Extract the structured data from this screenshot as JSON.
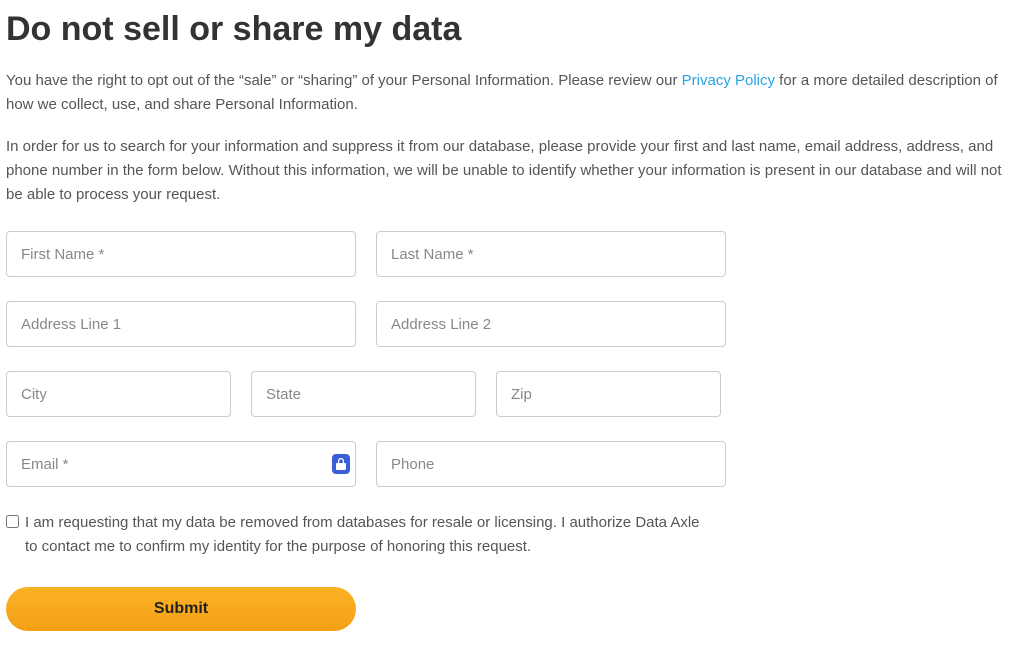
{
  "title": "Do not sell or share my data",
  "intro1_pre": "You have the right to opt out of the “sale” or “sharing” of your Personal Information. Please review our ",
  "privacy_link_text": "Privacy Policy",
  "intro1_post": " for a more detailed description of how we collect, use, and share Personal Information.",
  "intro2": "In order for us to search for your information and suppress it from our database, please provide your first and last name, email address, address, and phone number in the form below. Without this information, we will be unable to identify whether your information is present in our database and will not be able to process your request.",
  "form": {
    "first_name_placeholder": "First Name *",
    "last_name_placeholder": "Last Name *",
    "address1_placeholder": "Address Line 1",
    "address2_placeholder": "Address Line 2",
    "city_placeholder": "City",
    "state_placeholder": "State",
    "zip_placeholder": "Zip",
    "email_placeholder": "Email *",
    "phone_placeholder": "Phone",
    "consent_label": "I am requesting that my data be removed from databases for resale or licensing. I authorize Data Axle to contact me to confirm my identity for the purpose of honoring this request.",
    "submit_label": "Submit"
  }
}
